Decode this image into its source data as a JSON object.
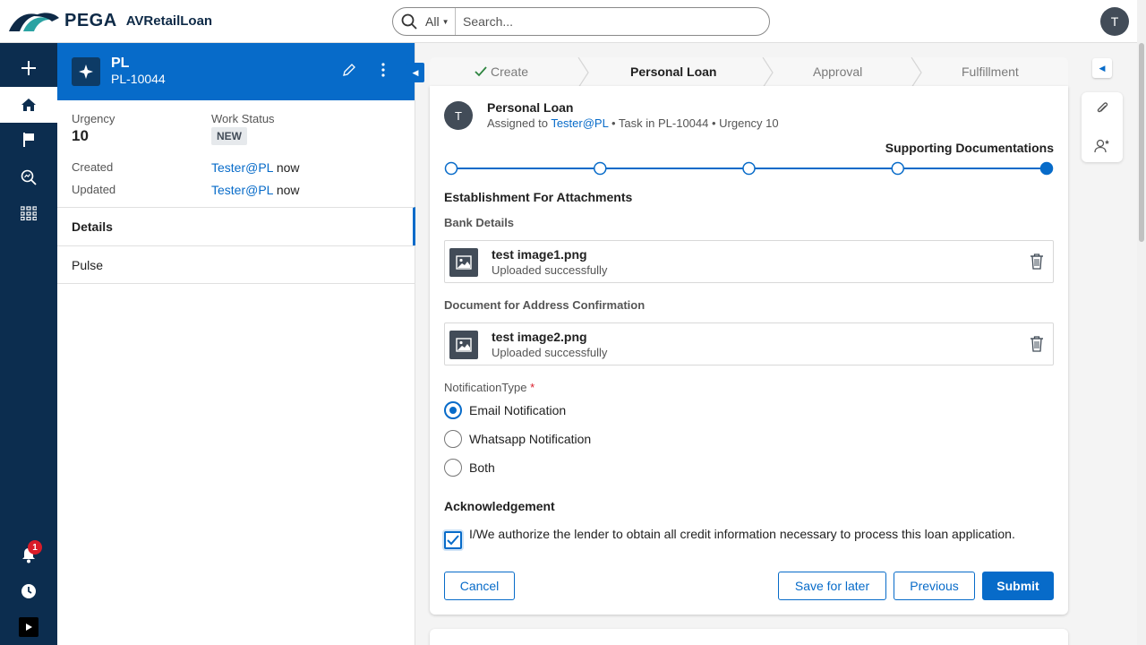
{
  "header": {
    "brand": "PEGA",
    "app_name": "AVRetailLoan",
    "search": {
      "scope": "All",
      "placeholder": "Search..."
    },
    "user_initial": "T"
  },
  "leftnav": {
    "items": [
      {
        "name": "create",
        "icon": "plus-icon"
      },
      {
        "name": "home",
        "icon": "home-icon",
        "active": true
      },
      {
        "name": "flag",
        "icon": "flag-icon"
      },
      {
        "name": "explore-data",
        "icon": "search-data-icon"
      },
      {
        "name": "apps",
        "icon": "grid-icon"
      }
    ],
    "bottom": {
      "notifications_count": "1",
      "recents_icon": "clock-icon",
      "devstudio_icon": "play-icon"
    }
  },
  "case": {
    "title": "PL",
    "id": "PL-10044",
    "urgency_label": "Urgency",
    "urgency_value": "10",
    "status_label": "Work Status",
    "status_value": "NEW",
    "created_label": "Created",
    "created_by": "Tester@PL",
    "created_when": "now",
    "updated_label": "Updated",
    "updated_by": "Tester@PL",
    "updated_when": "now",
    "tabs": [
      "Details",
      "Pulse"
    ]
  },
  "stages": {
    "items": [
      "Create",
      "Personal Loan",
      "Approval",
      "Fulfillment"
    ],
    "completed": "Create",
    "current": "Personal Loan"
  },
  "assignment": {
    "avatar_initial": "T",
    "title": "Personal Loan",
    "assigned_prefix": "Assigned to",
    "assignee": "Tester@PL",
    "task": "• Task in PL-10044 • Urgency 10",
    "current_step": "Supporting Documentations",
    "step_count": 5,
    "current_step_index": 5
  },
  "form": {
    "section_title": "Establishment For Attachments",
    "bank_label": "Bank Details",
    "file1_name": "test image1.png",
    "file1_status": "Uploaded successfully",
    "address_label": "Document for Address Confirmation",
    "file2_name": "test image2.png",
    "file2_status": "Uploaded successfully",
    "notification_label": "NotificationType",
    "required_mark": "*",
    "notification_options": [
      "Email Notification",
      "Whatsapp Notification",
      "Both"
    ],
    "notification_selected": "Email Notification",
    "ack_title": "Acknowledgement",
    "ack_text": "I/We authorize the lender to obtain all credit information necessary to process this loan application.",
    "ack_checked": true
  },
  "actions": {
    "cancel": "Cancel",
    "save_for_later": "Save for later",
    "previous": "Previous",
    "submit": "Submit"
  },
  "colors": {
    "primary": "#076bc9",
    "nav_bg": "#0c2d4f",
    "badge": "#d91c29"
  }
}
